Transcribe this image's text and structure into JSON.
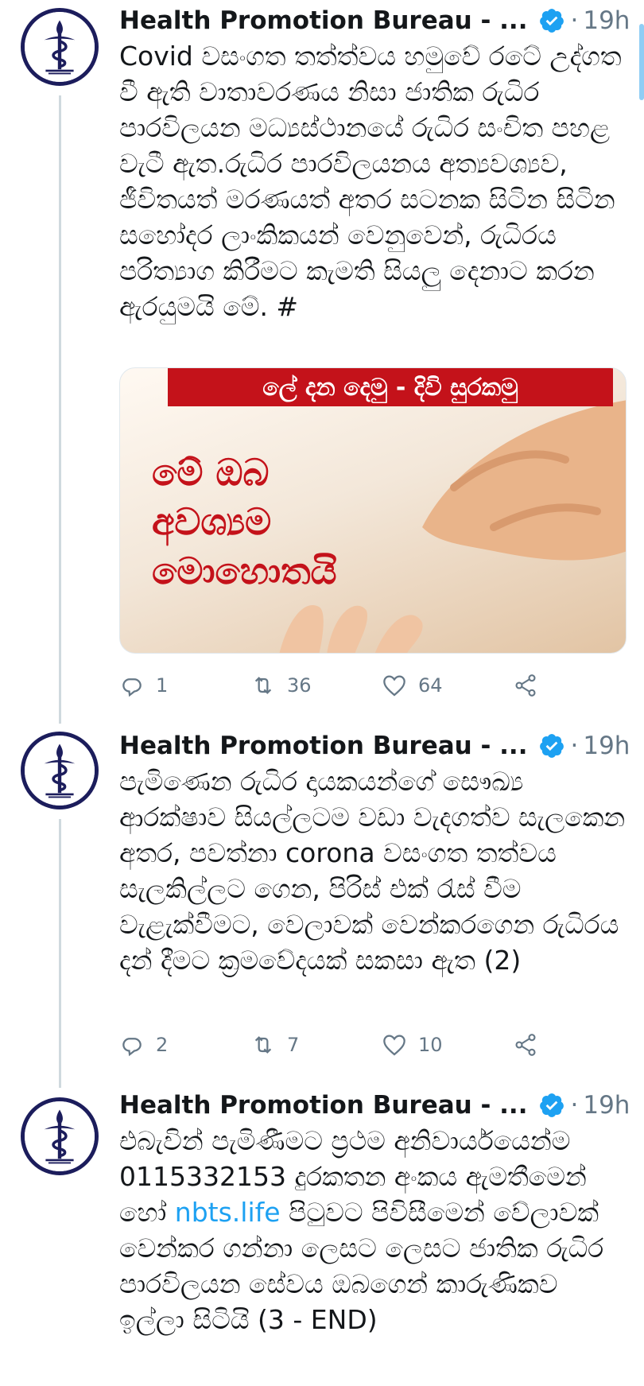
{
  "colors": {
    "accent": "#1da1f2",
    "text": "#14171a",
    "muted": "#657786",
    "thread": "#cfd9de",
    "banner": "#c4121a"
  },
  "tweets": [
    {
      "author": "Health Promotion Bureau - ...",
      "time": "19h",
      "dot": "·",
      "text": "Covid වසංගත තත්ත්වය හමුවේ රටේ උද්ගත වී ඇති වාතාවරණය නිසා ජාතික රුධිර පාරවිලයන මධ්‍යස්ථානයේ රුධිර සංචිත පහළ වැටී ඇත.රුධිර පාරවිලයනය අත්‍යවශ්‍යව, ජීවිතයත් මරණයත් අතර සටනක සිටින සිටින සහෝදර ලාංකිකයන් වෙනුවෙන්, රුධිරය පරිත්‍යාග කිරීමට කැමති සියලු දෙනාට කරන ඇරයුමයි මේ. #",
      "media": {
        "banner": "ලේ දන දෙමු - දිවි සුරකමු",
        "headline": [
          "මේ ඔබ",
          "අවශ්‍යම",
          "මොහොතයි"
        ]
      },
      "replies": "1",
      "retweets": "36",
      "likes": "64"
    },
    {
      "author": "Health Promotion Bureau - ...",
      "time": "19h",
      "dot": "·",
      "text": "පැමිණෙන රුධිර දායකයන්ගේ සෞඛ්‍ය ආරක්ෂාව සියල්ලටම වඩා වැදගත්ව සැලකෙන අතර, පවත්නා corona වසංගත තත්වය සැලකිල්ලට ගෙන, පිරිස් එක් රැස් වීම වැළැක්වීමට, වෙලාවක් වෙන්කරගෙන රුධිරය දන් දීමට ක්‍රමවේදයක් සකසා ඇත (2)",
      "replies": "2",
      "retweets": "7",
      "likes": "10"
    },
    {
      "author": "Health Promotion Bureau - ...",
      "time": "19h",
      "dot": "·",
      "text_before": "එබැවින් පැමිණීමට ප්‍රථම අනිවාර්යයෙන්ම 0115332153 දුරකතන අංකය ඇමතීමෙන් හෝ ",
      "link": "nbts.life",
      "text_after": " පිටුවට පිවිසීමෙන් වේලාවක් වෙන්කර ගන්නා ලෙසට ලෙසට ජාතික රුධිර පාරවිලයන සේවය ඔබගෙන් කාරුණිකව ඉල්ලා සිටියි (3 - END)"
    }
  ]
}
